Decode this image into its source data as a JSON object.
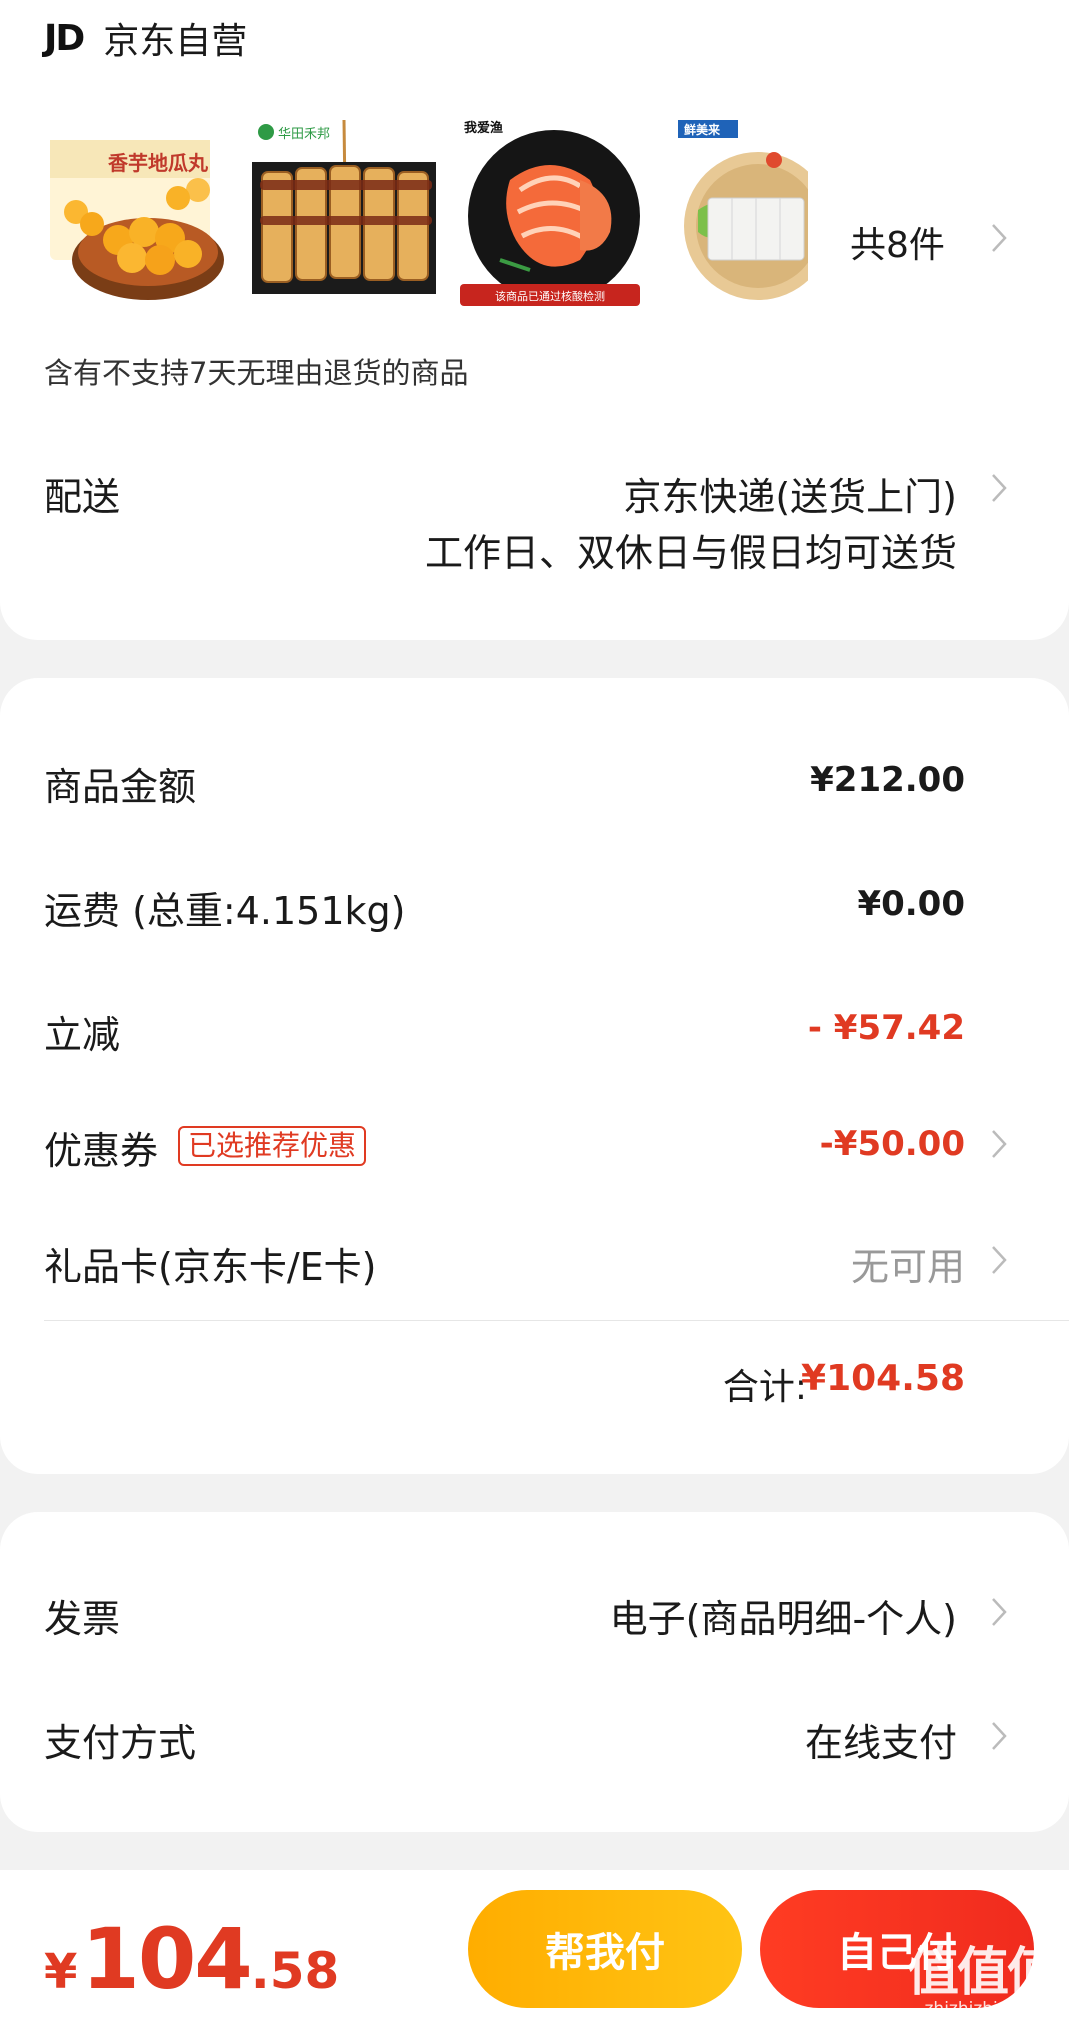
{
  "store": {
    "logo_text": "JD",
    "name": "京东自营"
  },
  "products": {
    "items": [
      {
        "label_1": "香芋地瓜丸",
        "label_2": ""
      },
      {
        "label_1": "华田禾邦",
        "label_2": ""
      },
      {
        "label_1": "我爱渔",
        "label_2": "该商品已通过核酸检测"
      },
      {
        "label_1": "鲜美来",
        "label_2": ""
      }
    ],
    "count_text": "共8件",
    "notice": "含有不支持7天无理由退货的商品"
  },
  "delivery": {
    "label": "配送",
    "method": "京东快递(送货上门)",
    "schedule": "工作日、双休日与假日均可送货"
  },
  "summary": {
    "goods_label": "商品金额",
    "goods_amount": "¥212.00",
    "shipping_label": "运费 (总重:4.151kg)",
    "shipping_amount": "¥0.00",
    "discount_label": "立减",
    "discount_amount": "- ¥57.42",
    "coupon_label": "优惠券",
    "coupon_tag": "已选推荐优惠",
    "coupon_amount": "-¥50.00",
    "giftcard_label": "礼品卡(京东卡/E卡)",
    "giftcard_value": "无可用",
    "total_label": "合计:",
    "total_amount": "¥104.58"
  },
  "invoice": {
    "label": "发票",
    "value": "电子(商品明细-个人)"
  },
  "payment": {
    "label": "支付方式",
    "value": "在线支付"
  },
  "bottom_bar": {
    "currency": "¥",
    "price_int": "104",
    "price_dec": ".58",
    "help_pay_label": "帮我付",
    "self_pay_label": "自己付"
  },
  "watermark": {
    "big": "值值值",
    "small": "zhizhizhi.com"
  },
  "colors": {
    "accent_red": "#e03a22",
    "help_button": "#ffb300",
    "self_button": "#f3341f",
    "page_bg": "#f2f2f2"
  }
}
